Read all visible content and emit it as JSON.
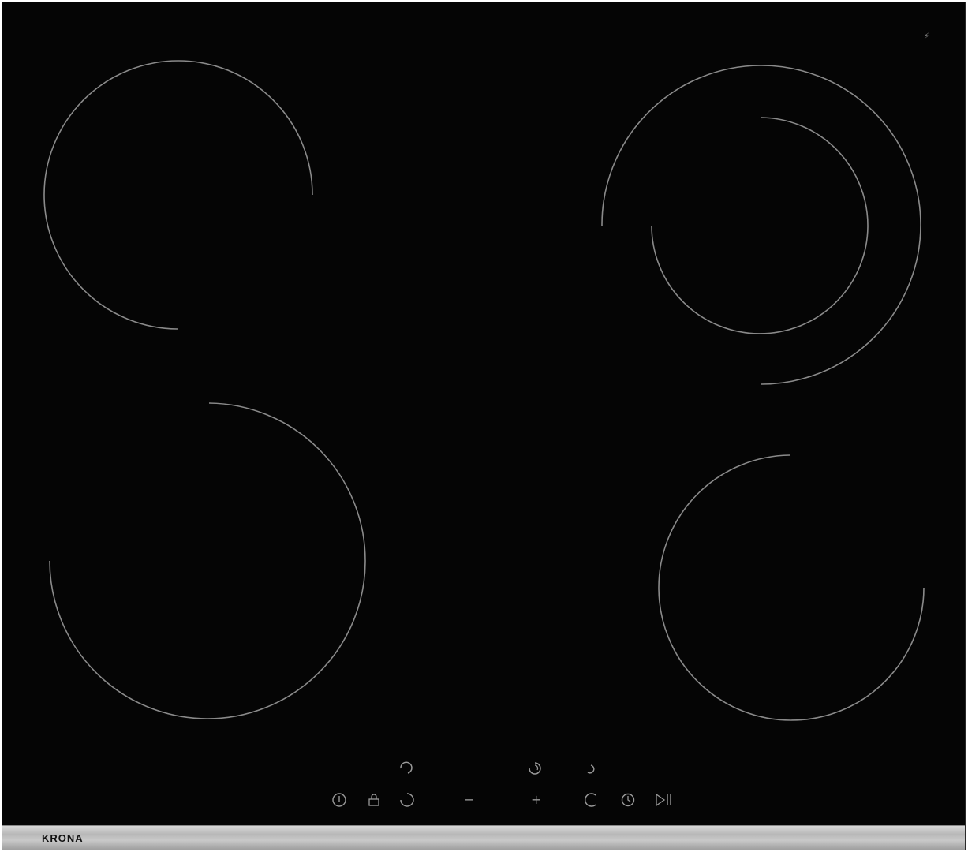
{
  "brand": {
    "name": "KRONA"
  },
  "corner_mark": {
    "text": "⚡︎"
  },
  "controls": {
    "zone_selectors": [
      "zone-front-left",
      "zone-rear-left",
      "zone-rear-right",
      "zone-front-right"
    ],
    "minus_symbol": "−",
    "plus_symbol": "+"
  },
  "colors": {
    "glass": "#050505",
    "ring_line": "#8a8a8a",
    "trim": "#c0c0c0",
    "control_symbol": "#9a9a9a"
  },
  "icons": [
    "power-icon",
    "lock-icon",
    "minus-icon",
    "plus-icon",
    "timer-icon",
    "play-pause-icon",
    "zone-selector-icon"
  ]
}
